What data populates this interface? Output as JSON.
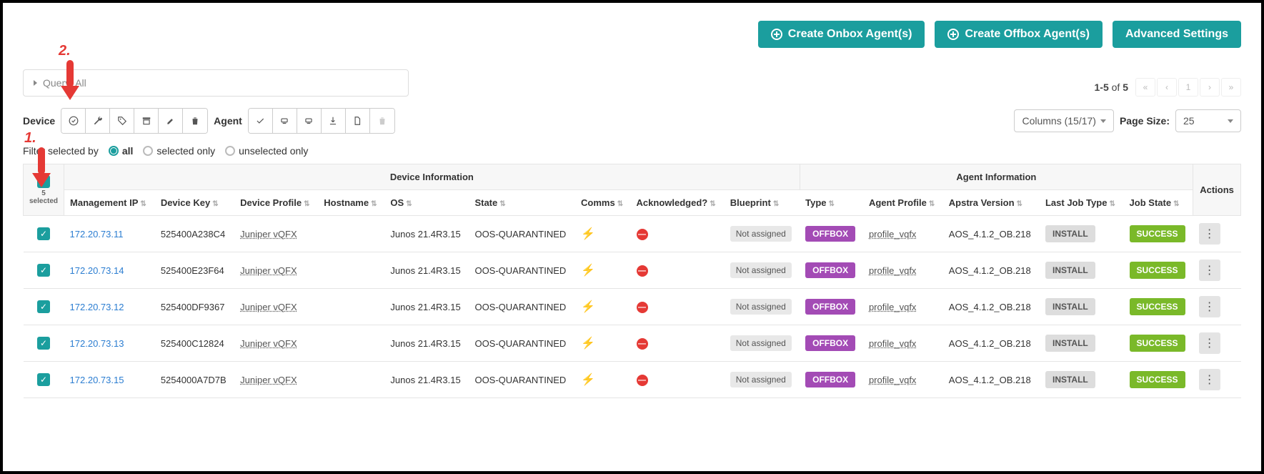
{
  "actions": {
    "create_onbox": "Create Onbox Agent(s)",
    "create_offbox": "Create Offbox Agent(s)",
    "advanced": "Advanced Settings"
  },
  "query": {
    "label": "Query: All"
  },
  "device_label": "Device",
  "agent_label": "Agent",
  "columns_sel": "Columns (15/17)",
  "page_size_label": "Page Size:",
  "page_size_value": "25",
  "pagination": {
    "range": "1-5",
    "of": "of",
    "total": "5"
  },
  "filter": {
    "label": "Filter selected by",
    "all": "all",
    "selected": "selected only",
    "unselected": "unselected only"
  },
  "annot": {
    "one": "1.",
    "two": "2."
  },
  "groups": {
    "device": "Device Information",
    "agent": "Agent Information"
  },
  "headers": {
    "mgmt_ip": "Management IP",
    "device_key": "Device Key",
    "device_profile": "Device Profile",
    "hostname": "Hostname",
    "os": "OS",
    "state": "State",
    "comms": "Comms",
    "ack": "Acknowledged?",
    "blueprint": "Blueprint",
    "type": "Type",
    "agent_profile": "Agent Profile",
    "apstra_ver": "Apstra Version",
    "last_job": "Last Job Type",
    "job_state": "Job State",
    "actions": "Actions"
  },
  "selected_text": "5 selected",
  "rows": [
    {
      "ip": "172.20.73.11",
      "key": "525400A238C4",
      "profile": "Juniper vQFX",
      "hostname": "",
      "os": "Junos 21.4R3.15",
      "state": "OOS-QUARANTINED",
      "blueprint": "Not assigned",
      "type": "OFFBOX",
      "agent_profile": "profile_vqfx",
      "ver": "AOS_4.1.2_OB.218",
      "job": "INSTALL",
      "job_state": "SUCCESS"
    },
    {
      "ip": "172.20.73.14",
      "key": "525400E23F64",
      "profile": "Juniper vQFX",
      "hostname": "",
      "os": "Junos 21.4R3.15",
      "state": "OOS-QUARANTINED",
      "blueprint": "Not assigned",
      "type": "OFFBOX",
      "agent_profile": "profile_vqfx",
      "ver": "AOS_4.1.2_OB.218",
      "job": "INSTALL",
      "job_state": "SUCCESS"
    },
    {
      "ip": "172.20.73.12",
      "key": "525400DF9367",
      "profile": "Juniper vQFX",
      "hostname": "",
      "os": "Junos 21.4R3.15",
      "state": "OOS-QUARANTINED",
      "blueprint": "Not assigned",
      "type": "OFFBOX",
      "agent_profile": "profile_vqfx",
      "ver": "AOS_4.1.2_OB.218",
      "job": "INSTALL",
      "job_state": "SUCCESS"
    },
    {
      "ip": "172.20.73.13",
      "key": "525400C12824",
      "profile": "Juniper vQFX",
      "hostname": "",
      "os": "Junos 21.4R3.15",
      "state": "OOS-QUARANTINED",
      "blueprint": "Not assigned",
      "type": "OFFBOX",
      "agent_profile": "profile_vqfx",
      "ver": "AOS_4.1.2_OB.218",
      "job": "INSTALL",
      "job_state": "SUCCESS"
    },
    {
      "ip": "172.20.73.15",
      "key": "5254000A7D7B",
      "profile": "Juniper vQFX",
      "hostname": "",
      "os": "Junos 21.4R3.15",
      "state": "OOS-QUARANTINED",
      "blueprint": "Not assigned",
      "type": "OFFBOX",
      "agent_profile": "profile_vqfx",
      "ver": "AOS_4.1.2_OB.218",
      "job": "INSTALL",
      "job_state": "SUCCESS"
    }
  ]
}
